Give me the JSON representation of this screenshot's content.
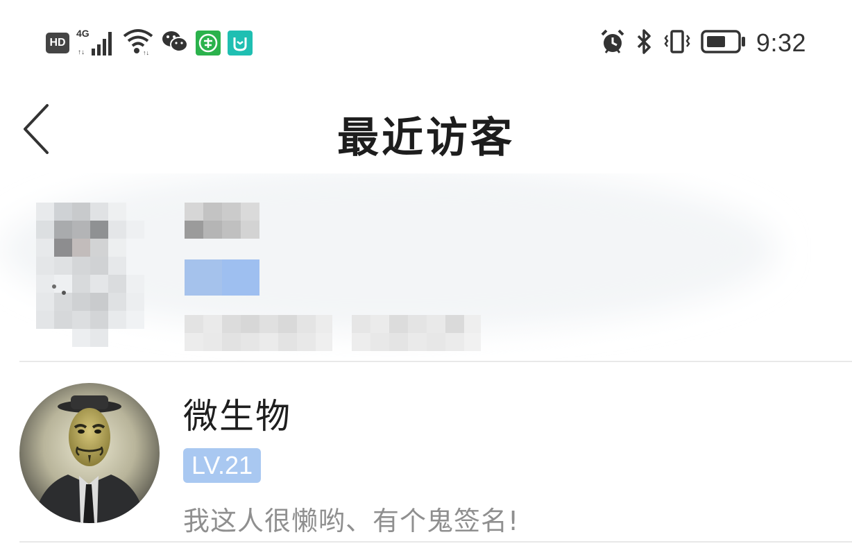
{
  "status_bar": {
    "hd_label": "HD",
    "network_label": "4G",
    "time": "9:32",
    "icons": [
      "hd-icon",
      "cellular-signal-icon",
      "wifi-icon",
      "wechat-icon",
      "app-green-icon",
      "mi-home-icon",
      "alarm-icon",
      "bluetooth-icon",
      "vibrate-icon",
      "battery-icon"
    ],
    "colors": {
      "green_app": "#2bb24c",
      "teal_app": "#1fbfb2"
    }
  },
  "header": {
    "title": "最近访客",
    "back_icon": "chevron-left-icon"
  },
  "visitors": [
    {
      "redacted": true
    },
    {
      "redacted": false,
      "name": "微生物",
      "level": "LV.21",
      "signature": "我这人很懒哟、有个鬼签名!"
    }
  ],
  "colors": {
    "level_badge": "#a9c8f1",
    "divider": "#e8e8e8",
    "signature_text": "#8f8f8f"
  }
}
